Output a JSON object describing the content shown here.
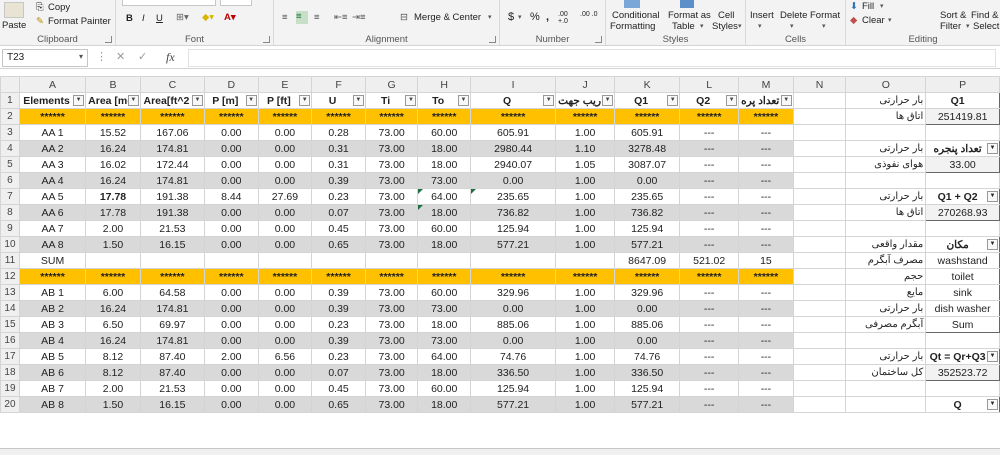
{
  "ribbon": {
    "clipboard": {
      "label": "Clipboard",
      "paste": "Paste",
      "copy": "Copy",
      "format_painter": "Format Painter"
    },
    "font": {
      "label": "Font",
      "bold": "B",
      "italic": "I",
      "underline": "U"
    },
    "alignment": {
      "label": "Alignment",
      "merge_center": "Merge & Center"
    },
    "number": {
      "label": "Number",
      "currency": "$",
      "percent": "%",
      "comma": ",",
      "inc_decimal": ".00 +.0",
      "dec_decimal": ".00 .0"
    },
    "styles": {
      "label": "Styles",
      "conditional": "Conditional",
      "formatting": "Formatting",
      "format_as": "Format as",
      "table": "Table",
      "cell": "Cell",
      "styles": "Styles"
    },
    "cells": {
      "label": "Cells",
      "insert": "Insert",
      "delete": "Delete",
      "format": "Format"
    },
    "editing": {
      "label": "Editing",
      "fill": "Fill",
      "clear": "Clear",
      "sort": "Sort &",
      "filter": "Filter",
      "find": "Find &",
      "select": "Select"
    }
  },
  "formula_bar": {
    "name_box": "T23",
    "fx": "fx",
    "formula": ""
  },
  "columns": [
    "A",
    "B",
    "C",
    "D",
    "E",
    "F",
    "G",
    "H",
    "I",
    "J",
    "K",
    "L",
    "M",
    "N",
    "O",
    "P"
  ],
  "rows": [
    {
      "n": "1",
      "type": "hdr",
      "cells": [
        "Elements",
        "Area [m^",
        "Area[ft^2",
        "P [m]",
        "P [ft]",
        "U",
        "Ti",
        "To",
        "Q",
        "ریب جهت",
        "Q1",
        "Q2",
        "تعداد پره"
      ],
      "o": "بار حرارتی",
      "p": "Q1"
    },
    {
      "n": "2",
      "type": "gold",
      "cells": [
        "******",
        "******",
        "******",
        "******",
        "******",
        "******",
        "******",
        "******",
        "******",
        "******",
        "******",
        "******",
        "******"
      ],
      "o": "اتاق ها",
      "p": "251419.81"
    },
    {
      "n": "3",
      "type": "white",
      "cells": [
        "AA 1",
        "15.52",
        "167.06",
        "0.00",
        "0.00",
        "0.28",
        "73.00",
        "60.00",
        "605.91",
        "1.00",
        "605.91",
        "---",
        "---"
      ],
      "o": "",
      "p": ""
    },
    {
      "n": "4",
      "type": "gray",
      "cells": [
        "AA 2",
        "16.24",
        "174.81",
        "0.00",
        "0.00",
        "0.31",
        "73.00",
        "18.00",
        "2980.44",
        "1.10",
        "3278.48",
        "---",
        "---"
      ],
      "o": "بار حرارتی",
      "p": "تعداد پنجره"
    },
    {
      "n": "5",
      "type": "white",
      "cells": [
        "AA 3",
        "16.02",
        "172.44",
        "0.00",
        "0.00",
        "0.31",
        "73.00",
        "18.00",
        "2940.07",
        "1.05",
        "3087.07",
        "---",
        "---"
      ],
      "o": "هوای نفوذی",
      "p": "33.00"
    },
    {
      "n": "6",
      "type": "gray",
      "cells": [
        "AA 4",
        "16.24",
        "174.81",
        "0.00",
        "0.00",
        "0.39",
        "73.00",
        "73.00",
        "0.00",
        "1.00",
        "0.00",
        "---",
        "---"
      ],
      "o": "",
      "p": ""
    },
    {
      "n": "7",
      "type": "white",
      "cells": [
        "AA 5",
        "17.78",
        "191.38",
        "8.44",
        "27.69",
        "0.23",
        "73.00",
        "64.00",
        "235.65",
        "1.00",
        "235.65",
        "---",
        "---"
      ],
      "o": "بار حرارتی",
      "p": "Q1 + Q2"
    },
    {
      "n": "8",
      "type": "gray",
      "cells": [
        "AA 6",
        "17.78",
        "191.38",
        "0.00",
        "0.00",
        "0.07",
        "73.00",
        "18.00",
        "736.82",
        "1.00",
        "736.82",
        "---",
        "---"
      ],
      "o": "اتاق ها",
      "p": "270268.93"
    },
    {
      "n": "9",
      "type": "white",
      "cells": [
        "AA 7",
        "2.00",
        "21.53",
        "0.00",
        "0.00",
        "0.45",
        "73.00",
        "60.00",
        "125.94",
        "1.00",
        "125.94",
        "---",
        "---"
      ],
      "o": "",
      "p": ""
    },
    {
      "n": "10",
      "type": "gray",
      "cells": [
        "AA 8",
        "1.50",
        "16.15",
        "0.00",
        "0.00",
        "0.65",
        "73.00",
        "18.00",
        "577.21",
        "1.00",
        "577.21",
        "---",
        "---"
      ],
      "o": "مقدار واقعی",
      "p": "مکان"
    },
    {
      "n": "11",
      "type": "white",
      "cells": [
        "SUM",
        "",
        "",
        "",
        "",
        "",
        "",
        "",
        "",
        "",
        "8647.09",
        "521.02",
        "15"
      ],
      "o": "مصرف آبگرم",
      "p": "washstand"
    },
    {
      "n": "12",
      "type": "gold",
      "cells": [
        "******",
        "******",
        "******",
        "******",
        "******",
        "******",
        "******",
        "******",
        "******",
        "******",
        "******",
        "******",
        "******"
      ],
      "o": "حجم",
      "p": "toilet"
    },
    {
      "n": "13",
      "type": "white",
      "cells": [
        "AB 1",
        "6.00",
        "64.58",
        "0.00",
        "0.00",
        "0.39",
        "73.00",
        "60.00",
        "329.96",
        "1.00",
        "329.96",
        "---",
        "---"
      ],
      "o": "مایع",
      "p": "sink"
    },
    {
      "n": "14",
      "type": "gray",
      "cells": [
        "AB 2",
        "16.24",
        "174.81",
        "0.00",
        "0.00",
        "0.39",
        "73.00",
        "73.00",
        "0.00",
        "1.00",
        "0.00",
        "---",
        "---"
      ],
      "o": "بار حرارتی",
      "p": "dish washer"
    },
    {
      "n": "15",
      "type": "white",
      "cells": [
        "AB 3",
        "6.50",
        "69.97",
        "0.00",
        "0.00",
        "0.23",
        "73.00",
        "18.00",
        "885.06",
        "1.00",
        "885.06",
        "---",
        "---"
      ],
      "o": "آبگرم مصرفی",
      "p": "Sum"
    },
    {
      "n": "16",
      "type": "gray",
      "cells": [
        "AB 4",
        "16.24",
        "174.81",
        "0.00",
        "0.00",
        "0.39",
        "73.00",
        "73.00",
        "0.00",
        "1.00",
        "0.00",
        "---",
        "---"
      ],
      "o": "",
      "p": ""
    },
    {
      "n": "17",
      "type": "white",
      "cells": [
        "AB 5",
        "8.12",
        "87.40",
        "2.00",
        "6.56",
        "0.23",
        "73.00",
        "64.00",
        "74.76",
        "1.00",
        "74.76",
        "---",
        "---"
      ],
      "o": "بار حرارتی",
      "p": "Qt = Qr+Q3"
    },
    {
      "n": "18",
      "type": "gray",
      "cells": [
        "AB 6",
        "8.12",
        "87.40",
        "0.00",
        "0.00",
        "0.07",
        "73.00",
        "18.00",
        "336.50",
        "1.00",
        "336.50",
        "---",
        "---"
      ],
      "o": "کل ساختمان",
      "p": "352523.72"
    },
    {
      "n": "19",
      "type": "white",
      "cells": [
        "AB 7",
        "2.00",
        "21.53",
        "0.00",
        "0.00",
        "0.45",
        "73.00",
        "60.00",
        "125.94",
        "1.00",
        "125.94",
        "---",
        "---"
      ],
      "o": "",
      "p": ""
    },
    {
      "n": "20",
      "type": "gray",
      "cells": [
        "AB 8",
        "1.50",
        "16.15",
        "0.00",
        "0.00",
        "0.65",
        "73.00",
        "18.00",
        "577.21",
        "1.00",
        "577.21",
        "---",
        "---"
      ],
      "o": "",
      "p": "Q"
    }
  ]
}
